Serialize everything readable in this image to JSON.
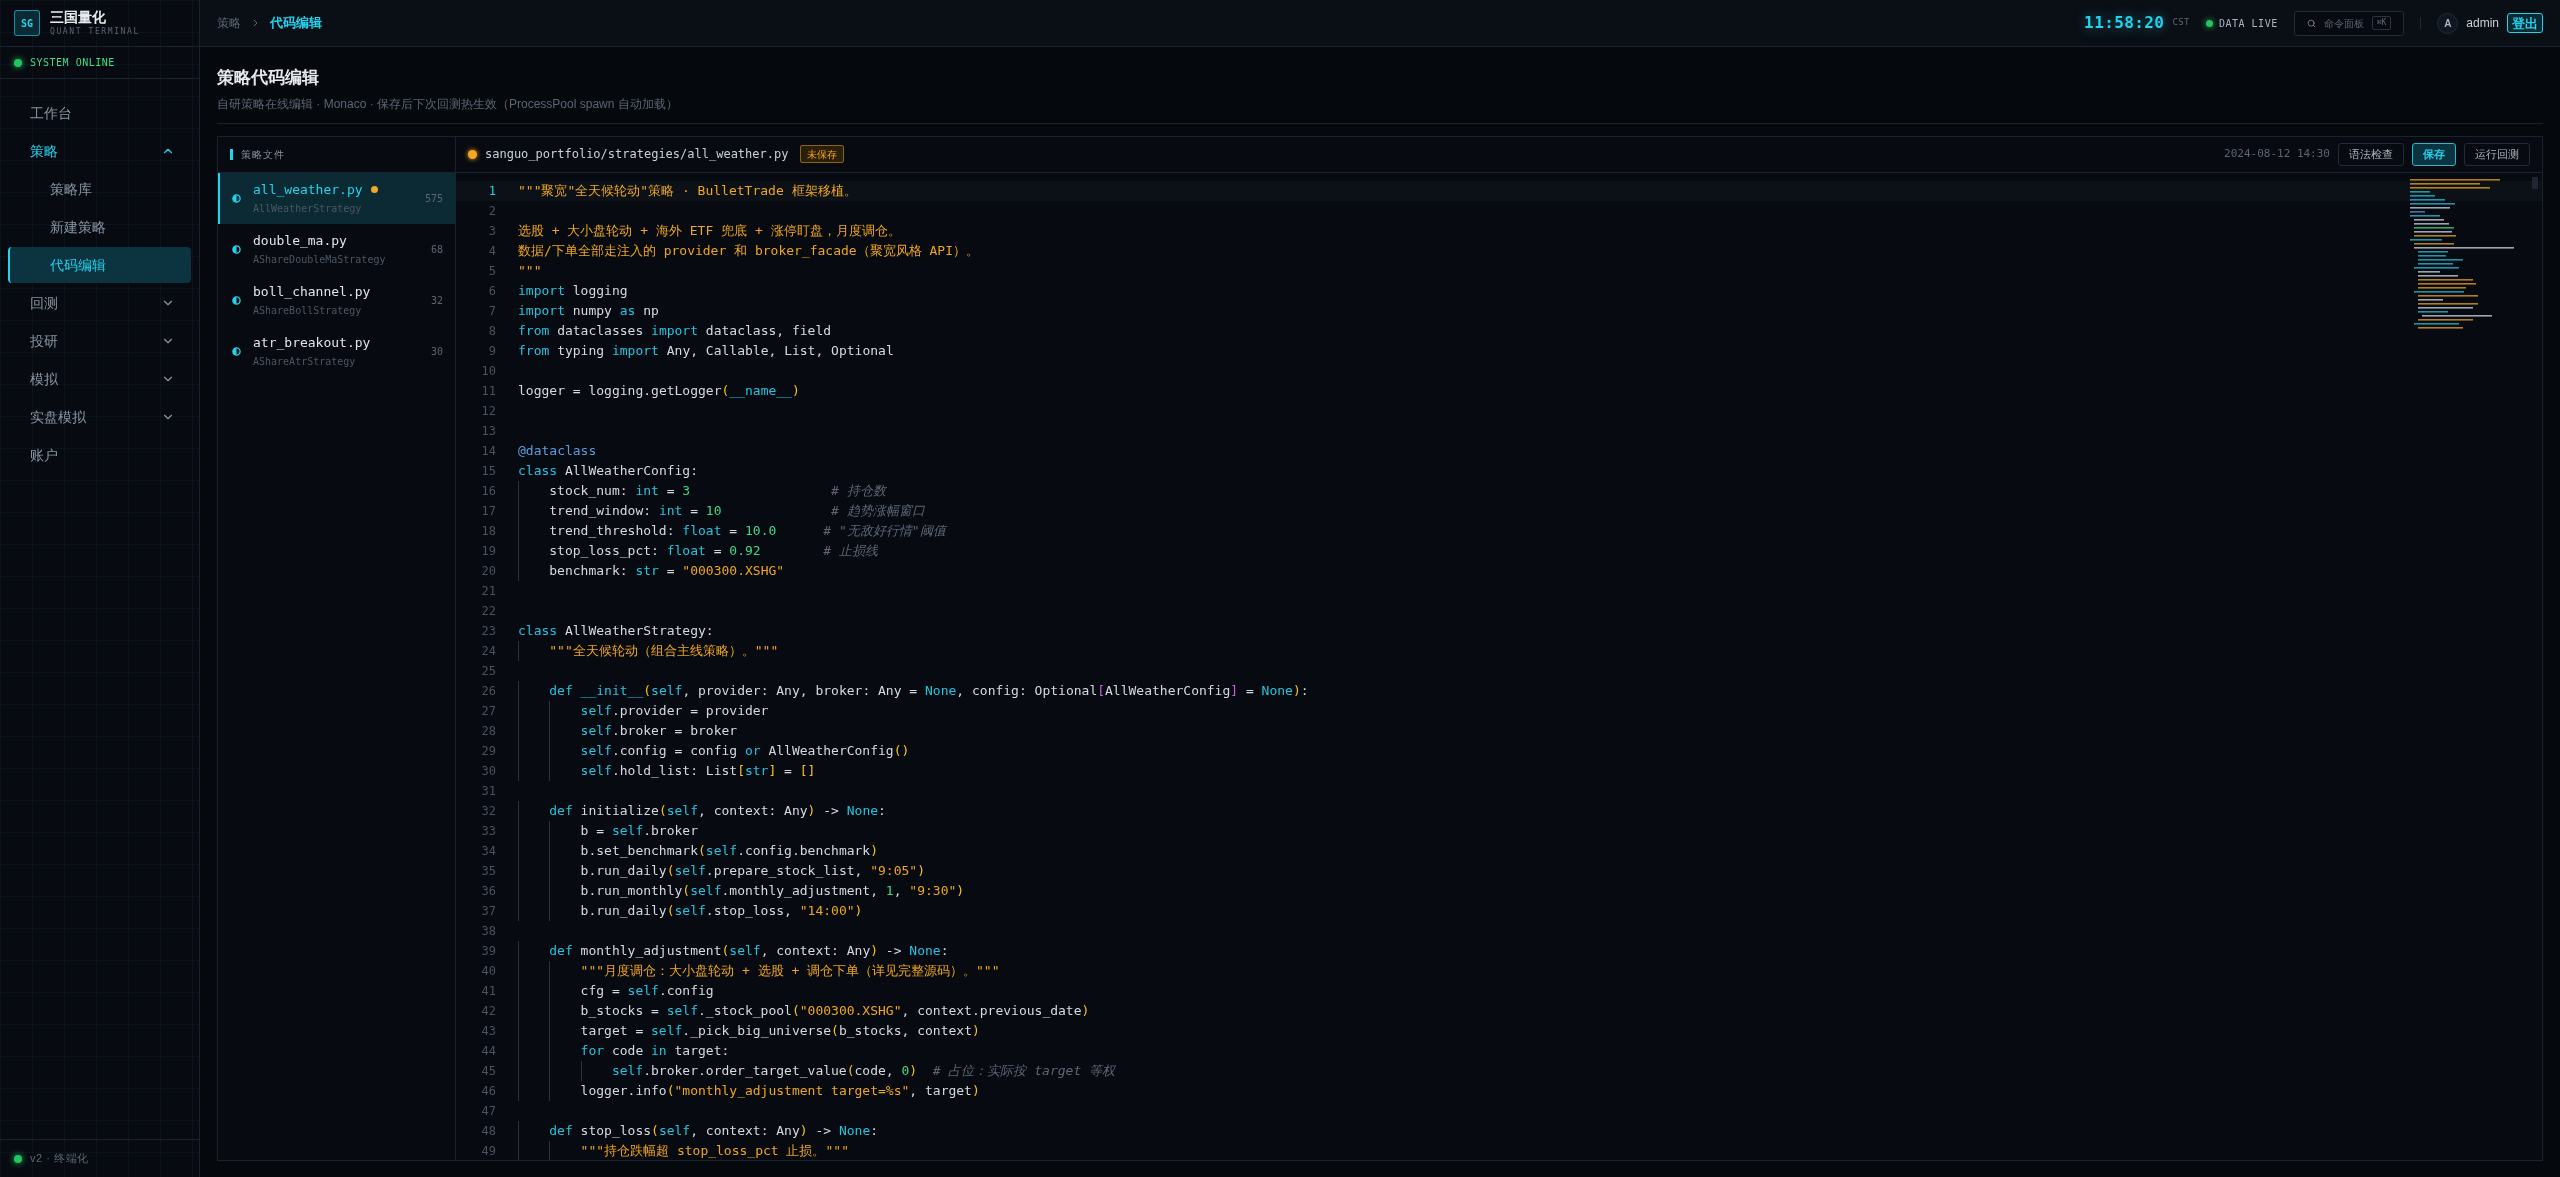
{
  "sidebar": {
    "logo": {
      "mark": "SG",
      "title": "三国量化",
      "subtitle": "QUANT TERMINAL"
    },
    "status": "SYSTEM ONLINE",
    "items": [
      {
        "label": "工作台",
        "selected": false
      },
      {
        "label": "策略",
        "selected": false,
        "expanded": true,
        "children": [
          {
            "label": "策略库",
            "selected": false
          },
          {
            "label": "新建策略",
            "selected": false
          },
          {
            "label": "代码编辑",
            "selected": true
          }
        ]
      },
      {
        "label": "回测",
        "selected": false,
        "expanded": false
      },
      {
        "label": "投研",
        "selected": false,
        "expanded": false
      },
      {
        "label": "模拟",
        "selected": false,
        "expanded": false
      },
      {
        "label": "实盘模拟",
        "selected": false,
        "expanded": false
      },
      {
        "label": "账户",
        "selected": false
      }
    ],
    "footer": "v2 · 终端化"
  },
  "header": {
    "breadcrumb": [
      "策略",
      "代码编辑"
    ],
    "clock": "11:58:20",
    "timezone": "CST",
    "feed_status": "DATA LIVE",
    "command_palette": {
      "label": "命令面板",
      "shortcut": "⌘K"
    },
    "avatar": "A",
    "user": "admin",
    "logout": "登出"
  },
  "page": {
    "title": "策略代码编辑",
    "subtitle": "自研策略在线编辑 · Monaco · 保存后下次回测热生效（ProcessPool spawn 自动加载）"
  },
  "file_list": {
    "title": "策略文件",
    "files": [
      {
        "name": "all_weather.py",
        "class": "AllWeatherStrategy",
        "lines": "575",
        "selected": true,
        "modified": true
      },
      {
        "name": "double_ma.py",
        "class": "AShareDoubleMaStrategy",
        "lines": "68",
        "selected": false,
        "modified": false
      },
      {
        "name": "boll_channel.py",
        "class": "AShareBollStrategy",
        "lines": "32",
        "selected": false,
        "modified": false
      },
      {
        "name": "atr_breakout.py",
        "class": "AShareAtrStrategy",
        "lines": "30",
        "selected": false,
        "modified": false
      }
    ]
  },
  "editor": {
    "path": "sanguo_portfolio/strategies/all_weather.py",
    "unsaved": true,
    "unsaved_label": "未保存",
    "timestamp": "2024-08-12 14:30",
    "buttons": [
      {
        "label": "语法检查",
        "primary": false
      },
      {
        "label": "保存",
        "primary": true
      },
      {
        "label": "运行回测",
        "primary": false
      }
    ],
    "lines": [
      {
        "no": "1",
        "current": true,
        "tokens": [
          {
            "kind": "str",
            "text": "\"\"\"聚宽\"全天候轮动\"策略 · BulletTrade 框架移植。"
          }
        ]
      },
      {
        "no": "2",
        "current": false
      },
      {
        "no": "3",
        "current": false,
        "tokens": [
          {
            "kind": "str",
            "text": "选股 + 大小盘轮动 + 海外 ETF 兜底 + 涨停盯盘，月度调仓。"
          }
        ]
      },
      {
        "no": "4",
        "current": false,
        "tokens": [
          {
            "kind": "str",
            "text": "数据/下单全部走注入的 provider 和 broker_facade（聚宽风格 API）。"
          }
        ]
      },
      {
        "no": "5",
        "current": false,
        "tokens": [
          {
            "kind": "str",
            "text": "\"\"\""
          }
        ]
      },
      {
        "no": "6",
        "current": false,
        "tokens": [
          {
            "kind": "kw",
            "text": "import"
          },
          {
            "kind": "p",
            "text": " logging"
          }
        ]
      },
      {
        "no": "7",
        "current": false,
        "tokens": [
          {
            "kind": "kw",
            "text": "import"
          },
          {
            "kind": "p",
            "text": " numpy "
          },
          {
            "kind": "kw",
            "text": "as"
          },
          {
            "kind": "p",
            "text": " np"
          }
        ]
      },
      {
        "no": "8",
        "current": false,
        "tokens": [
          {
            "kind": "kw",
            "text": "from"
          },
          {
            "kind": "p",
            "text": " dataclasses "
          },
          {
            "kind": "kw",
            "text": "import"
          },
          {
            "kind": "p",
            "text": " dataclass, field"
          }
        ]
      },
      {
        "no": "9",
        "current": false,
        "tokens": [
          {
            "kind": "kw",
            "text": "from"
          },
          {
            "kind": "p",
            "text": " typing "
          },
          {
            "kind": "kw",
            "text": "import"
          },
          {
            "kind": "p",
            "text": " Any, Callable, List, Optional"
          }
        ]
      },
      {
        "no": "10",
        "current": false
      },
      {
        "no": "11",
        "current": false,
        "tokens": [
          {
            "kind": "p",
            "text": "logger = logging.getLogger"
          },
          {
            "kind": "br",
            "text": "("
          },
          {
            "kind": "kw",
            "text": "__name__"
          },
          {
            "kind": "br",
            "text": ")"
          }
        ]
      },
      {
        "no": "12",
        "current": false
      },
      {
        "no": "13",
        "current": false
      },
      {
        "no": "14",
        "current": false,
        "tokens": [
          {
            "kind": "deco",
            "text": "@dataclass"
          }
        ]
      },
      {
        "no": "15",
        "current": false,
        "tokens": [
          {
            "kind": "kw",
            "text": "class"
          },
          {
            "kind": "p",
            "text": " AllWeatherConfig:"
          }
        ]
      },
      {
        "no": "16",
        "current": false,
        "tokens": [
          {
            "kind": "p",
            "text": "    stock_num: "
          },
          {
            "kind": "kw",
            "text": "int"
          },
          {
            "kind": "p",
            "text": " = "
          },
          {
            "kind": "num",
            "text": "3"
          },
          {
            "kind": "cmt",
            "text": "                  # 持仓数"
          }
        ]
      },
      {
        "no": "17",
        "current": false,
        "tokens": [
          {
            "kind": "p",
            "text": "    trend_window: "
          },
          {
            "kind": "kw",
            "text": "int"
          },
          {
            "kind": "p",
            "text": " = "
          },
          {
            "kind": "num",
            "text": "10"
          },
          {
            "kind": "cmt",
            "text": "              # 趋势涨幅窗口"
          }
        ]
      },
      {
        "no": "18",
        "current": false,
        "tokens": [
          {
            "kind": "p",
            "text": "    trend_threshold: "
          },
          {
            "kind": "kw",
            "text": "float"
          },
          {
            "kind": "p",
            "text": " = "
          },
          {
            "kind": "num",
            "text": "10.0"
          },
          {
            "kind": "cmt",
            "text": "      # \"无敌好行情\"阈值"
          }
        ]
      },
      {
        "no": "19",
        "current": false,
        "tokens": [
          {
            "kind": "p",
            "text": "    stop_loss_pct: "
          },
          {
            "kind": "kw",
            "text": "float"
          },
          {
            "kind": "p",
            "text": " = "
          },
          {
            "kind": "num",
            "text": "0.92"
          },
          {
            "kind": "cmt",
            "text": "        # 止损线"
          }
        ]
      },
      {
        "no": "20",
        "current": false,
        "tokens": [
          {
            "kind": "p",
            "text": "    benchmark: "
          },
          {
            "kind": "kw",
            "text": "str"
          },
          {
            "kind": "p",
            "text": " = "
          },
          {
            "kind": "str",
            "text": "\"000300.XSHG\""
          }
        ]
      },
      {
        "no": "21",
        "current": false
      },
      {
        "no": "22",
        "current": false
      },
      {
        "no": "23",
        "current": false,
        "tokens": [
          {
            "kind": "kw",
            "text": "class"
          },
          {
            "kind": "p",
            "text": " AllWeatherStrategy:"
          }
        ]
      },
      {
        "no": "24",
        "current": false,
        "tokens": [
          {
            "kind": "str",
            "text": "    \"\"\"全天候轮动（组合主线策略）。\"\"\""
          }
        ]
      },
      {
        "no": "25",
        "current": false
      },
      {
        "no": "26",
        "current": false,
        "tokens": [
          {
            "kind": "kw",
            "text": "    def "
          },
          {
            "kind": "kw",
            "text": "__init__"
          },
          {
            "kind": "br",
            "text": "("
          },
          {
            "kind": "self",
            "text": "self"
          },
          {
            "kind": "p",
            "text": ", provider: Any, broker: Any = "
          },
          {
            "kind": "kw",
            "text": "None"
          },
          {
            "kind": "p",
            "text": ", config: Optional"
          },
          {
            "kind": "br2",
            "text": "["
          },
          {
            "kind": "p",
            "text": "AllWeatherConfig"
          },
          {
            "kind": "br2",
            "text": "]"
          },
          {
            "kind": "p",
            "text": " = "
          },
          {
            "kind": "kw",
            "text": "None"
          },
          {
            "kind": "br",
            "text": ")"
          },
          {
            "kind": "p",
            "text": ":"
          }
        ]
      },
      {
        "no": "27",
        "current": false,
        "tokens": [
          {
            "kind": "self",
            "text": "        self"
          },
          {
            "kind": "p",
            "text": ".provider = provider"
          }
        ]
      },
      {
        "no": "28",
        "current": false,
        "tokens": [
          {
            "kind": "self",
            "text": "        self"
          },
          {
            "kind": "p",
            "text": ".broker = broker"
          }
        ]
      },
      {
        "no": "29",
        "current": false,
        "tokens": [
          {
            "kind": "self",
            "text": "        self"
          },
          {
            "kind": "p",
            "text": ".config = config "
          },
          {
            "kind": "kw",
            "text": "or"
          },
          {
            "kind": "p",
            "text": " AllWeatherConfig"
          },
          {
            "kind": "br",
            "text": "()"
          }
        ]
      },
      {
        "no": "30",
        "current": false,
        "tokens": [
          {
            "kind": "self",
            "text": "        self"
          },
          {
            "kind": "p",
            "text": ".hold_list: List"
          },
          {
            "kind": "br",
            "text": "["
          },
          {
            "kind": "kw",
            "text": "str"
          },
          {
            "kind": "br",
            "text": "]"
          },
          {
            "kind": "p",
            "text": " = "
          },
          {
            "kind": "br",
            "text": "[]"
          }
        ]
      },
      {
        "no": "31",
        "current": false
      },
      {
        "no": "32",
        "current": false,
        "tokens": [
          {
            "kind": "kw",
            "text": "    def"
          },
          {
            "kind": "p",
            "text": " initialize"
          },
          {
            "kind": "br",
            "text": "("
          },
          {
            "kind": "self",
            "text": "self"
          },
          {
            "kind": "p",
            "text": ", context: Any"
          },
          {
            "kind": "br",
            "text": ")"
          },
          {
            "kind": "p",
            "text": " -> "
          },
          {
            "kind": "kw",
            "text": "None"
          },
          {
            "kind": "p",
            "text": ":"
          }
        ]
      },
      {
        "no": "33",
        "current": false,
        "tokens": [
          {
            "kind": "p",
            "text": "        b = "
          },
          {
            "kind": "self",
            "text": "self"
          },
          {
            "kind": "p",
            "text": ".broker"
          }
        ]
      },
      {
        "no": "34",
        "current": false,
        "tokens": [
          {
            "kind": "p",
            "text": "        b.set_benchmark"
          },
          {
            "kind": "br",
            "text": "("
          },
          {
            "kind": "self",
            "text": "self"
          },
          {
            "kind": "p",
            "text": ".config.benchmark"
          },
          {
            "kind": "br",
            "text": ")"
          }
        ]
      },
      {
        "no": "35",
        "current": false,
        "tokens": [
          {
            "kind": "p",
            "text": "        b.run_daily"
          },
          {
            "kind": "br",
            "text": "("
          },
          {
            "kind": "self",
            "text": "self"
          },
          {
            "kind": "p",
            "text": ".prepare_stock_list, "
          },
          {
            "kind": "str",
            "text": "\"9:05\""
          },
          {
            "kind": "br",
            "text": ")"
          }
        ]
      },
      {
        "no": "36",
        "current": false,
        "tokens": [
          {
            "kind": "p",
            "text": "        b.run_monthly"
          },
          {
            "kind": "br",
            "text": "("
          },
          {
            "kind": "self",
            "text": "self"
          },
          {
            "kind": "p",
            "text": ".monthly_adjustment, "
          },
          {
            "kind": "num",
            "text": "1"
          },
          {
            "kind": "p",
            "text": ", "
          },
          {
            "kind": "str",
            "text": "\"9:30\""
          },
          {
            "kind": "br",
            "text": ")"
          }
        ]
      },
      {
        "no": "37",
        "current": false,
        "tokens": [
          {
            "kind": "p",
            "text": "        b.run_daily"
          },
          {
            "kind": "br",
            "text": "("
          },
          {
            "kind": "self",
            "text": "self"
          },
          {
            "kind": "p",
            "text": ".stop_loss, "
          },
          {
            "kind": "str",
            "text": "\"14:00\""
          },
          {
            "kind": "br",
            "text": ")"
          }
        ]
      },
      {
        "no": "38",
        "current": false
      },
      {
        "no": "39",
        "current": false,
        "tokens": [
          {
            "kind": "kw",
            "text": "    def"
          },
          {
            "kind": "p",
            "text": " monthly_adjustment"
          },
          {
            "kind": "br",
            "text": "("
          },
          {
            "kind": "self",
            "text": "self"
          },
          {
            "kind": "p",
            "text": ", context: Any"
          },
          {
            "kind": "br",
            "text": ")"
          },
          {
            "kind": "p",
            "text": " -> "
          },
          {
            "kind": "kw",
            "text": "None"
          },
          {
            "kind": "p",
            "text": ":"
          }
        ]
      },
      {
        "no": "40",
        "current": false,
        "tokens": [
          {
            "kind": "str",
            "text": "        \"\"\"月度调仓：大小盘轮动 + 选股 + 调仓下单（详见完整源码）。\"\"\""
          }
        ]
      },
      {
        "no": "41",
        "current": false,
        "tokens": [
          {
            "kind": "p",
            "text": "        cfg = "
          },
          {
            "kind": "self",
            "text": "self"
          },
          {
            "kind": "p",
            "text": ".config"
          }
        ]
      },
      {
        "no": "42",
        "current": false,
        "tokens": [
          {
            "kind": "p",
            "text": "        b_stocks = "
          },
          {
            "kind": "self",
            "text": "self"
          },
          {
            "kind": "p",
            "text": "._stock_pool"
          },
          {
            "kind": "br",
            "text": "("
          },
          {
            "kind": "str",
            "text": "\"000300.XSHG\""
          },
          {
            "kind": "p",
            "text": ", context.previous_date"
          },
          {
            "kind": "br",
            "text": ")"
          }
        ]
      },
      {
        "no": "43",
        "current": false,
        "tokens": [
          {
            "kind": "p",
            "text": "        target = "
          },
          {
            "kind": "self",
            "text": "self"
          },
          {
            "kind": "p",
            "text": "._pick_big_universe"
          },
          {
            "kind": "br",
            "text": "("
          },
          {
            "kind": "p",
            "text": "b_stocks, context"
          },
          {
            "kind": "br",
            "text": ")"
          }
        ]
      },
      {
        "no": "44",
        "current": false,
        "tokens": [
          {
            "kind": "kw",
            "text": "        for"
          },
          {
            "kind": "p",
            "text": " code "
          },
          {
            "kind": "kw",
            "text": "in"
          },
          {
            "kind": "p",
            "text": " target:"
          }
        ]
      },
      {
        "no": "45",
        "current": false,
        "tokens": [
          {
            "kind": "self",
            "text": "            self"
          },
          {
            "kind": "p",
            "text": ".broker.order_target_value"
          },
          {
            "kind": "br",
            "text": "("
          },
          {
            "kind": "p",
            "text": "code, "
          },
          {
            "kind": "num",
            "text": "0"
          },
          {
            "kind": "br",
            "text": ")"
          },
          {
            "kind": "cmt",
            "text": "  # 占位：实际按 target 等权"
          }
        ]
      },
      {
        "no": "46",
        "current": false,
        "tokens": [
          {
            "kind": "p",
            "text": "        logger.info"
          },
          {
            "kind": "br",
            "text": "("
          },
          {
            "kind": "str",
            "text": "\"monthly_adjustment target=%s\""
          },
          {
            "kind": "p",
            "text": ", target"
          },
          {
            "kind": "br",
            "text": ")"
          }
        ]
      },
      {
        "no": "47",
        "current": false
      },
      {
        "no": "48",
        "current": false,
        "tokens": [
          {
            "kind": "kw",
            "text": "    def"
          },
          {
            "kind": "p",
            "text": " stop_loss"
          },
          {
            "kind": "br",
            "text": "("
          },
          {
            "kind": "self",
            "text": "self"
          },
          {
            "kind": "p",
            "text": ", context: Any"
          },
          {
            "kind": "br",
            "text": ")"
          },
          {
            "kind": "p",
            "text": " -> "
          },
          {
            "kind": "kw",
            "text": "None"
          },
          {
            "kind": "p",
            "text": ":"
          }
        ]
      },
      {
        "no": "49",
        "current": false,
        "tokens": [
          {
            "kind": "str",
            "text": "        \"\"\"持仓跌幅超 stop_loss_pct 止损。\"\"\""
          }
        ]
      }
    ]
  }
}
